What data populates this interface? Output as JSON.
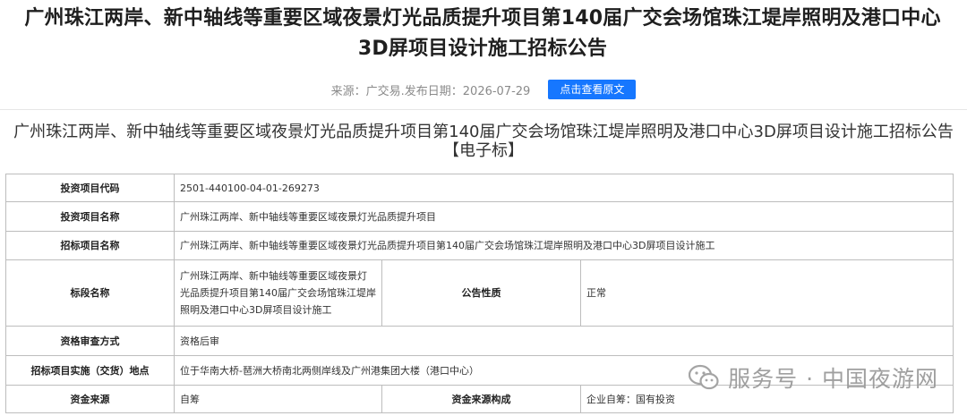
{
  "header": {
    "title": "广州珠江两岸、新中轴线等重要区域夜景灯光品质提升项目第140届广交会场馆珠江堤岸照明及港口中心3D屏项目设计施工招标公告",
    "source_label": "来源：广交易.",
    "date_label": "发布日期：2026-07-29",
    "view_original_label": "点击查看原文"
  },
  "subtitle": "广州珠江两岸、新中轴线等重要区域夜景灯光品质提升项目第140届广交会场馆珠江堤岸照明及港口中心3D屏项目设计施工招标公告【电子标】",
  "table": {
    "row1": {
      "label": "投资项目代码",
      "value": "2501-440100-04-01-269273"
    },
    "row2": {
      "label": "投资项目名称",
      "value": "广州珠江两岸、新中轴线等重要区域夜景灯光品质提升项目"
    },
    "row3": {
      "label": "招标项目名称",
      "value": "广州珠江两岸、新中轴线等重要区域夜景灯光品质提升项目第140届广交会场馆珠江堤岸照明及港口中心3D屏项目设计施工"
    },
    "row4": {
      "label": "标段名称",
      "value": "广州珠江两岸、新中轴线等重要区域夜景灯光品质提升项目第140届广交会场馆珠江堤岸照明及港口中心3D屏项目设计施工",
      "label2": "公告性质",
      "value2": "正常"
    },
    "row5": {
      "label": "资格审查方式",
      "value": "资格后审"
    },
    "row6": {
      "label": "招标项目实施（交货）地点",
      "value": "位于华南大桥-琶洲大桥南北两侧岸线及广州港集团大楼（港口中心）"
    },
    "row7": {
      "label": "资金来源",
      "value": "自筹",
      "label2": "资金来源构成",
      "value2": "企业自筹：国有投资"
    }
  },
  "watermark": {
    "icon": "wechat-icon",
    "text": "服务号 · 中国夜游网"
  },
  "colors": {
    "accent": "#1677ff",
    "border": "#bdbdbd",
    "muted_text": "#8a8a8a"
  }
}
